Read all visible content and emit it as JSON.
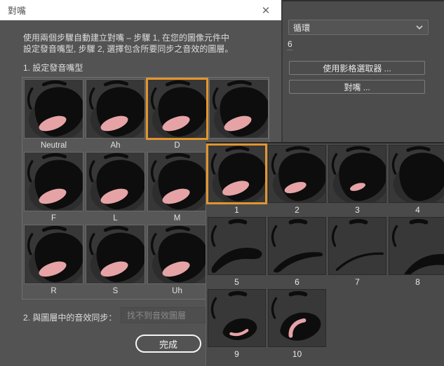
{
  "dialog": {
    "title": "對嘴",
    "close_icon": "✕",
    "instructions": "使用兩個步驟自動建立對嘴 – 步驟 1, 在您的圖像元件中\n設定發音嘴型, 步驟 2, 選擇包含所要同步之音效的圖層。",
    "step1_label": "1. 設定發音嘴型",
    "viseme_rows": [
      [
        {
          "label": "Neutral",
          "variant": "open-lg",
          "selected": false
        },
        {
          "label": "Ah",
          "variant": "open-lg",
          "selected": false
        },
        {
          "label": "D",
          "variant": "open-lg",
          "selected": true
        },
        {
          "label": "",
          "variant": "open-lg",
          "selected": false
        }
      ],
      [
        {
          "label": "F",
          "variant": "open-lg",
          "selected": false
        },
        {
          "label": "L",
          "variant": "open-lg",
          "selected": false
        },
        {
          "label": "M",
          "variant": "open-lg",
          "selected": false
        }
      ],
      [
        {
          "label": "R",
          "variant": "open-lg",
          "selected": false
        },
        {
          "label": "S",
          "variant": "open-lg",
          "selected": false
        },
        {
          "label": "Uh",
          "variant": "open-lg",
          "selected": false
        }
      ]
    ],
    "step2_label": "2. 與圖層中的音效同步：",
    "audio_layer_field": "找不到音效圖層",
    "done_button": "完成"
  },
  "properties_panel": {
    "loop_dropdown_value": "循環",
    "frame_value": "6",
    "frame_picker_button": "使用影格選取器 ...",
    "lip_sync_button": "對嘴 ..."
  },
  "frame_picker_popup": {
    "rows": [
      [
        {
          "label": "1",
          "variant": "open-lg",
          "selected": true
        },
        {
          "label": "2",
          "variant": "open-md",
          "selected": false
        },
        {
          "label": "3",
          "variant": "open-sm",
          "selected": false
        },
        {
          "label": "4",
          "variant": "open-none",
          "selected": false
        }
      ],
      [
        {
          "label": "5",
          "variant": "closed-thick",
          "selected": false
        },
        {
          "label": "6",
          "variant": "closed-med",
          "selected": false
        },
        {
          "label": "7",
          "variant": "closed-thin",
          "selected": false
        },
        {
          "label": "8",
          "variant": "closed-right",
          "selected": false
        }
      ],
      [
        {
          "label": "9",
          "variant": "tiny-a",
          "selected": false
        },
        {
          "label": "10",
          "variant": "tiny-b",
          "selected": false
        }
      ]
    ]
  },
  "colors": {
    "selection_orange": "#e2952f",
    "tongue_pink": "#e6a3a6",
    "mouth_black": "#0d0d0d",
    "titlebar_bg": "#ffffff",
    "dialog_bg": "#535353"
  }
}
